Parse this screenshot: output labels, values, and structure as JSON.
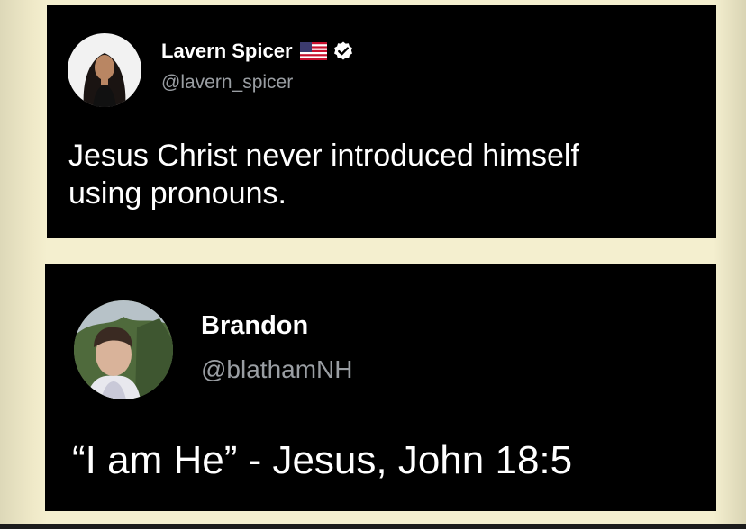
{
  "tweets": [
    {
      "display_name": "Lavern Spicer",
      "handle": "@lavern_spicer",
      "flag_icon": "us-flag-icon",
      "verified_icon": "verified-badge-icon",
      "text_line_1": "Jesus Christ never introduced himself",
      "text_line_2": "using pronouns."
    },
    {
      "display_name": "Brandon",
      "handle": "@blathamNH",
      "text": "“I am He” - Jesus, John 18:5"
    }
  ],
  "colors": {
    "tweet_background": "#000000",
    "page_background": "#f4efcf",
    "name_text": "#ffffff",
    "handle_text": "#9a9ea3"
  }
}
